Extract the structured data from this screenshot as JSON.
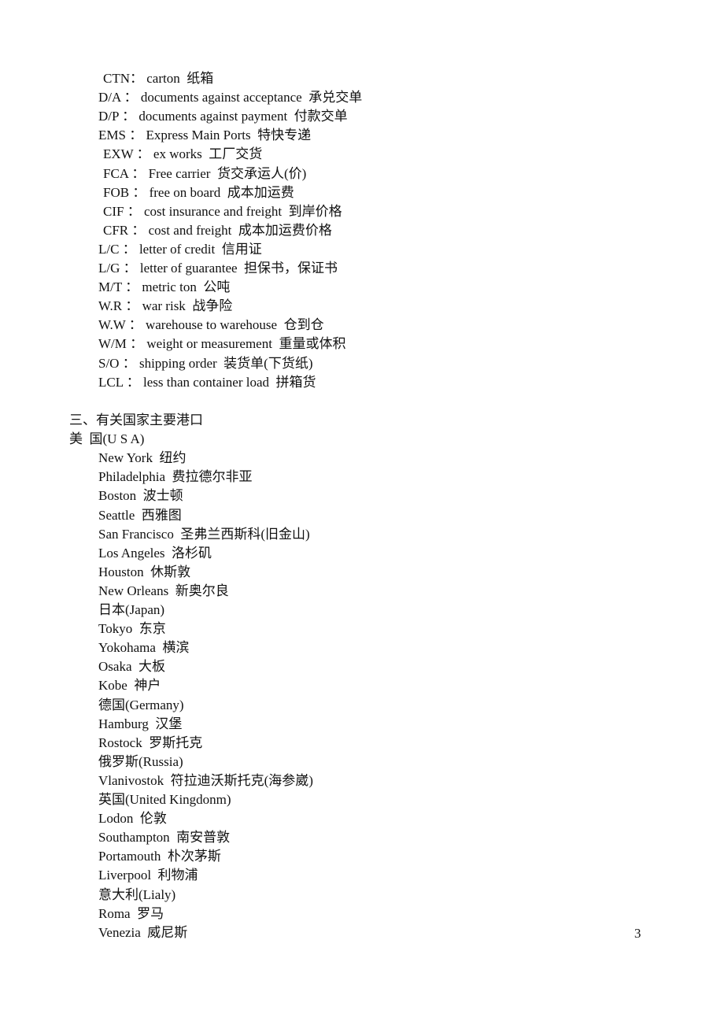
{
  "abbreviations": [
    {
      "abbr": "CTN",
      "sep": "：",
      "english": "carton",
      "chinese": "纸箱",
      "indent": 1
    },
    {
      "abbr": "D/A",
      "sep": " ：",
      "english": "documents against acceptance",
      "chinese": "承兑交单",
      "indent": 0
    },
    {
      "abbr": "D/P",
      "sep": " ：",
      "english": "documents against payment",
      "chinese": "付款交单",
      "indent": 0
    },
    {
      "abbr": "EMS",
      "sep": " ：",
      "english": "Express Main Ports",
      "chinese": "特快专递",
      "indent": 0
    },
    {
      "abbr": "EXW",
      "sep": " ：",
      "english": "ex works",
      "chinese": "工厂交货",
      "indent": 1
    },
    {
      "abbr": "FCA",
      "sep": " ：",
      "english": "Free carrier",
      "chinese": "货交承运人(价)",
      "indent": 1
    },
    {
      "abbr": "FOB",
      "sep": " ：",
      "english": "free on board",
      "chinese": "成本加运费",
      "indent": 1
    },
    {
      "abbr": "CIF",
      "sep": " ：",
      "english": "cost insurance and freight",
      "chinese": "到岸价格",
      "indent": 1
    },
    {
      "abbr": "CFR",
      "sep": " ：",
      "english": "cost and freight",
      "chinese": "成本加运费价格",
      "indent": 1
    },
    {
      "abbr": "L/C",
      "sep": " ：",
      "english": "letter of credit",
      "chinese": "信用证",
      "indent": 0
    },
    {
      "abbr": "L/G",
      "sep": " ：",
      "english": "letter of guarantee",
      "chinese": "担保书，保证书",
      "indent": 0
    },
    {
      "abbr": "M/T",
      "sep": " ：",
      "english": "metric ton",
      "chinese": "公吨",
      "indent": 0
    },
    {
      "abbr": "W.R",
      "sep": " ：",
      "english": "war risk",
      "chinese": "战争险",
      "indent": 0
    },
    {
      "abbr": "W.W",
      "sep": " ：",
      "english": "warehouse to warehouse",
      "chinese": "仓到仓",
      "indent": 0
    },
    {
      "abbr": "W/M",
      "sep": " ：",
      "english": "weight or measurement",
      "chinese": "重量或体积",
      "indent": 0
    },
    {
      "abbr": "S/O",
      "sep": " ：",
      "english": "shipping order",
      "chinese": "装货单(下货纸)",
      "indent": 0
    },
    {
      "abbr": "LCL",
      "sep": " ：",
      "english": "less than container load",
      "chinese": "拼箱货",
      "indent": 0
    }
  ],
  "section_heading": "三、有关国家主要港口",
  "ports_lines": [
    {
      "text": "美  国(U S A)",
      "kind": "country",
      "indent": 0
    },
    {
      "text": "New York  纽约",
      "kind": "port",
      "indent": 1
    },
    {
      "text": "Philadelphia  费拉德尔非亚",
      "kind": "port",
      "indent": 1
    },
    {
      "text": "Boston  波士顿",
      "kind": "port",
      "indent": 1
    },
    {
      "text": "Seattle  西雅图",
      "kind": "port",
      "indent": 1
    },
    {
      "text": "San Francisco  圣弗兰西斯科(旧金山)",
      "kind": "port",
      "indent": 1
    },
    {
      "text": "Los Angeles  洛杉矶",
      "kind": "port",
      "indent": 1
    },
    {
      "text": "Houston  休斯敦",
      "kind": "port",
      "indent": 1
    },
    {
      "text": "New Orleans  新奥尔良",
      "kind": "port",
      "indent": 1
    },
    {
      "text": "日本(Japan)",
      "kind": "country",
      "indent": 1
    },
    {
      "text": "Tokyo  东京",
      "kind": "port",
      "indent": 1
    },
    {
      "text": "Yokohama  横滨",
      "kind": "port",
      "indent": 1
    },
    {
      "text": "Osaka  大板",
      "kind": "port",
      "indent": 1
    },
    {
      "text": "Kobe  神户",
      "kind": "port",
      "indent": 1
    },
    {
      "text": "德国(Germany)",
      "kind": "country",
      "indent": 1
    },
    {
      "text": "Hamburg  汉堡",
      "kind": "port",
      "indent": 1
    },
    {
      "text": "Rostock  罗斯托克",
      "kind": "port",
      "indent": 1
    },
    {
      "text": "俄罗斯(Russia)",
      "kind": "country",
      "indent": 1
    },
    {
      "text": "Vlanivostok  符拉迪沃斯托克(海参崴)",
      "kind": "port",
      "indent": 1
    },
    {
      "text": "英国(United Kingdonm)",
      "kind": "country",
      "indent": 1
    },
    {
      "text": "Lodon  伦敦",
      "kind": "port",
      "indent": 1
    },
    {
      "text": "Southampton  南安普敦",
      "kind": "port",
      "indent": 1
    },
    {
      "text": "Portamouth  朴次茅斯",
      "kind": "port",
      "indent": 1
    },
    {
      "text": "Liverpool  利物浦",
      "kind": "port",
      "indent": 1
    },
    {
      "text": "意大利(Lialy)",
      "kind": "country",
      "indent": 1
    },
    {
      "text": "Roma  罗马",
      "kind": "port",
      "indent": 1
    },
    {
      "text": "Venezia  威尼斯",
      "kind": "port",
      "indent": 1
    }
  ],
  "page_number": "3"
}
